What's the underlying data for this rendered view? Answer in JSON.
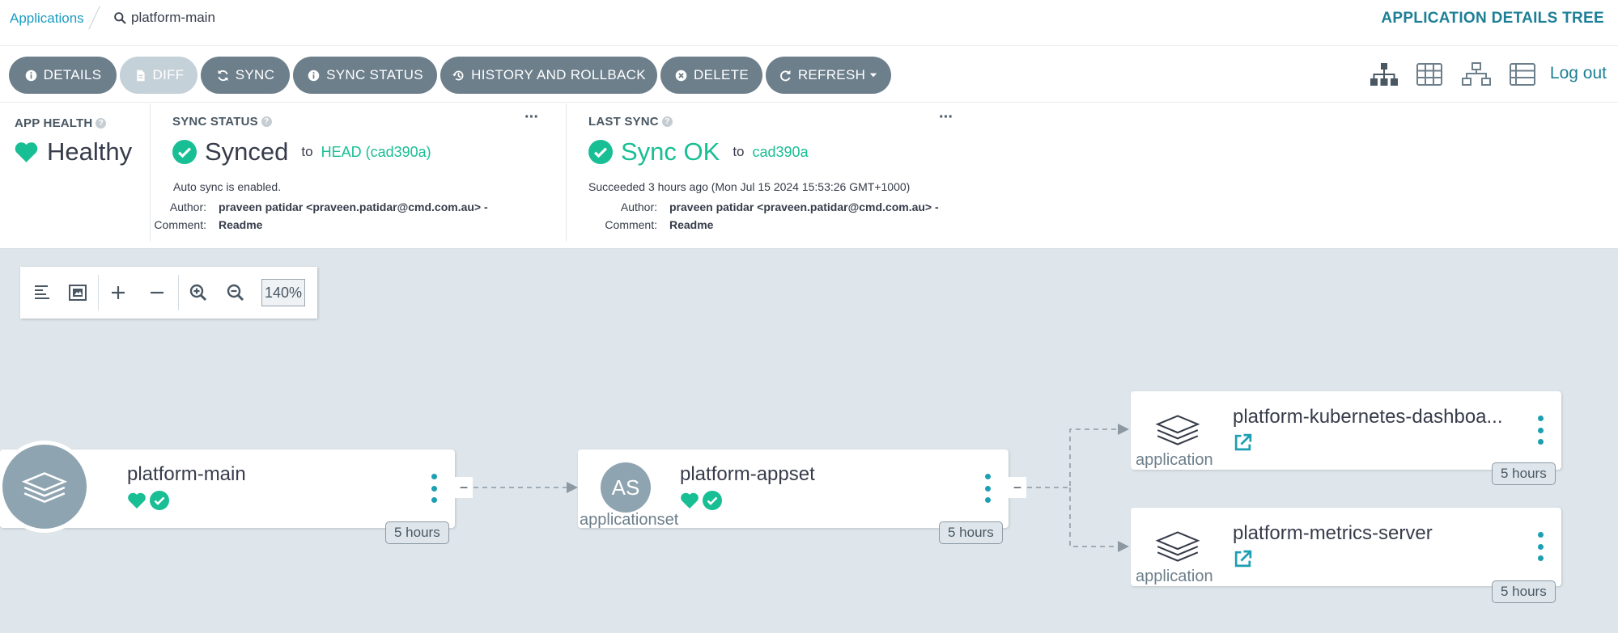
{
  "breadcrumb": {
    "root": "Applications",
    "current": "platform-main"
  },
  "page_title": "APPLICATION DETAILS TREE",
  "toolbar": {
    "buttons": [
      {
        "label": "DETAILS",
        "icon": "info-icon"
      },
      {
        "label": "DIFF",
        "icon": "file-icon",
        "disabled": true
      },
      {
        "label": "SYNC",
        "icon": "sync-icon"
      },
      {
        "label": "SYNC STATUS",
        "icon": "info-icon"
      },
      {
        "label": "HISTORY AND ROLLBACK",
        "icon": "history-icon"
      },
      {
        "label": "DELETE",
        "icon": "times-circle-icon"
      },
      {
        "label": "REFRESH",
        "icon": "redo-icon",
        "dropdown": true
      }
    ],
    "views": [
      "tree-view-icon",
      "pods-view-icon",
      "network-view-icon",
      "list-view-icon"
    ],
    "logout": "Log out"
  },
  "app_health": {
    "label": "APP HEALTH",
    "status": "Healthy"
  },
  "sync_status": {
    "label": "SYNC STATUS",
    "status": "Synced",
    "to": "to",
    "revision": "HEAD (cad390a)",
    "auto_sync": "Auto sync is enabled.",
    "author_label": "Author:",
    "author": "praveen patidar <praveen.patidar@cmd.com.au> -",
    "comment_label": "Comment:",
    "comment": "Readme"
  },
  "last_sync": {
    "label": "LAST SYNC",
    "status": "Sync OK",
    "to": "to",
    "revision": "cad390a",
    "result": "Succeeded 3 hours ago (Mon Jul 15 2024 15:53:26 GMT+1000)",
    "author_label": "Author:",
    "author": "praveen patidar <praveen.patidar@cmd.com.au> -",
    "comment_label": "Comment:",
    "comment": "Readme"
  },
  "graph": {
    "zoom": "140%",
    "nodes": {
      "main": {
        "title": "platform-main",
        "age": "5 hours"
      },
      "appset": {
        "title": "platform-appset",
        "kind": "applicationset",
        "avatar": "AS",
        "age": "5 hours"
      },
      "child1": {
        "title": "platform-kubernetes-dashboa...",
        "kind": "application",
        "age": "5 hours"
      },
      "child2": {
        "title": "platform-metrics-server",
        "kind": "application",
        "age": "5 hours"
      }
    }
  },
  "colors": {
    "accent": "#1d7f96",
    "healthy": "#18be94",
    "button": "#6d7f8b"
  }
}
